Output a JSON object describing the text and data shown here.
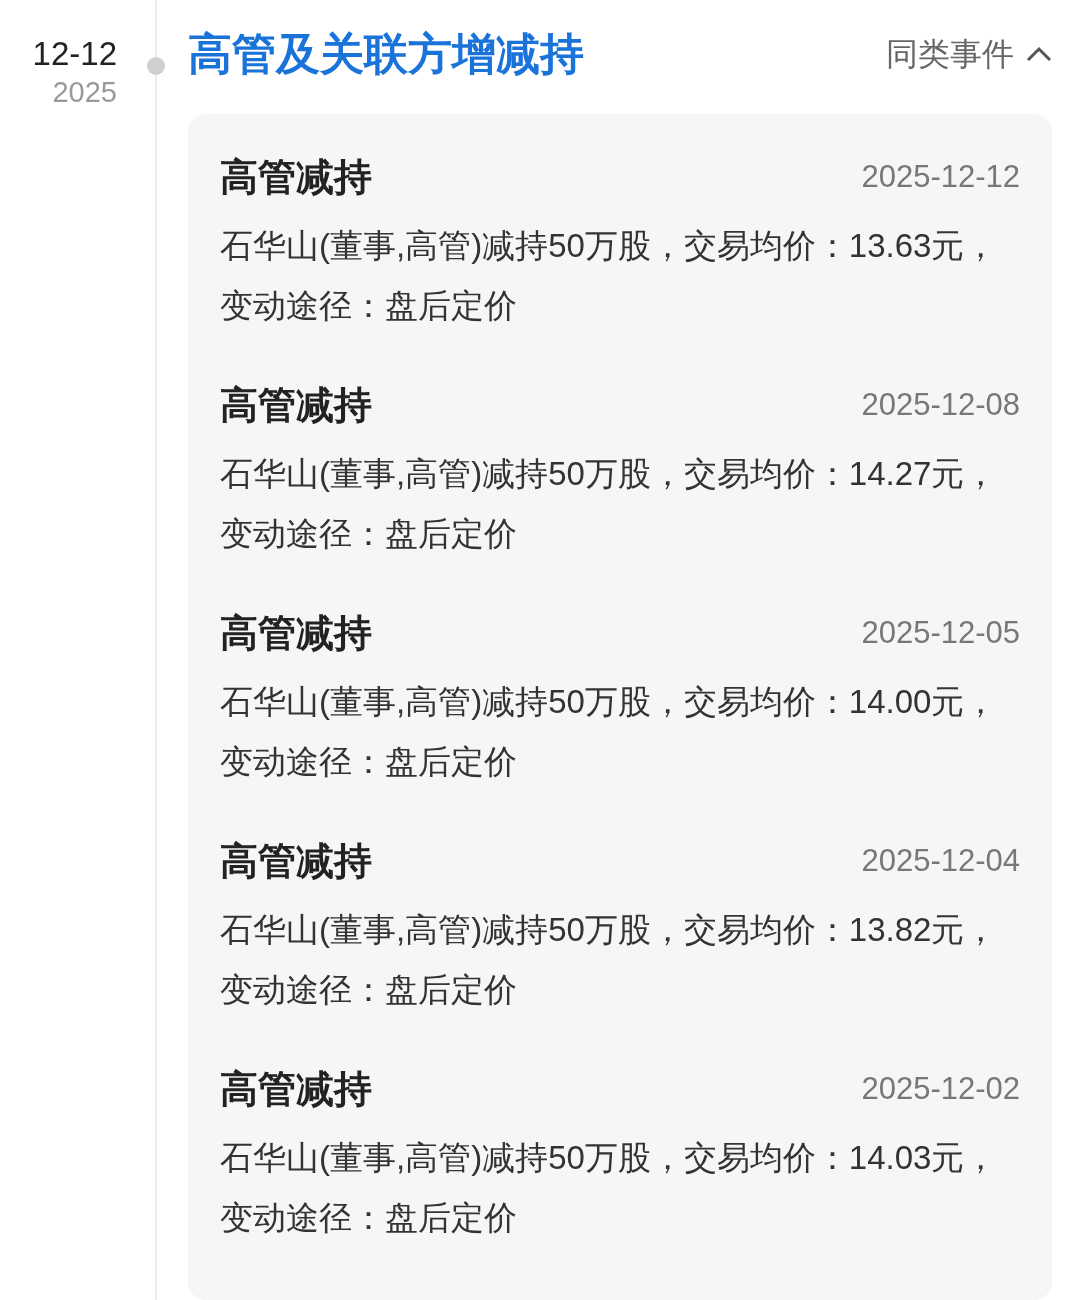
{
  "date": {
    "day": "12-12",
    "year": "2025"
  },
  "event": {
    "title": "高管及关联方增减持",
    "related_label": "同类事件",
    "expanded": true
  },
  "items": [
    {
      "title": "高管减持",
      "date": "2025-12-12",
      "description": "石华山(董事,高管)减持50万股，交易均价：13.63元，变动途径：盘后定价"
    },
    {
      "title": "高管减持",
      "date": "2025-12-08",
      "description": "石华山(董事,高管)减持50万股，交易均价：14.27元，变动途径：盘后定价"
    },
    {
      "title": "高管减持",
      "date": "2025-12-05",
      "description": "石华山(董事,高管)减持50万股，交易均价：14.00元，变动途径：盘后定价"
    },
    {
      "title": "高管减持",
      "date": "2025-12-04",
      "description": "石华山(董事,高管)减持50万股，交易均价：13.82元，变动途径：盘后定价"
    },
    {
      "title": "高管减持",
      "date": "2025-12-02",
      "description": "石华山(董事,高管)减持50万股，交易均价：14.03元，变动途径：盘后定价"
    }
  ]
}
